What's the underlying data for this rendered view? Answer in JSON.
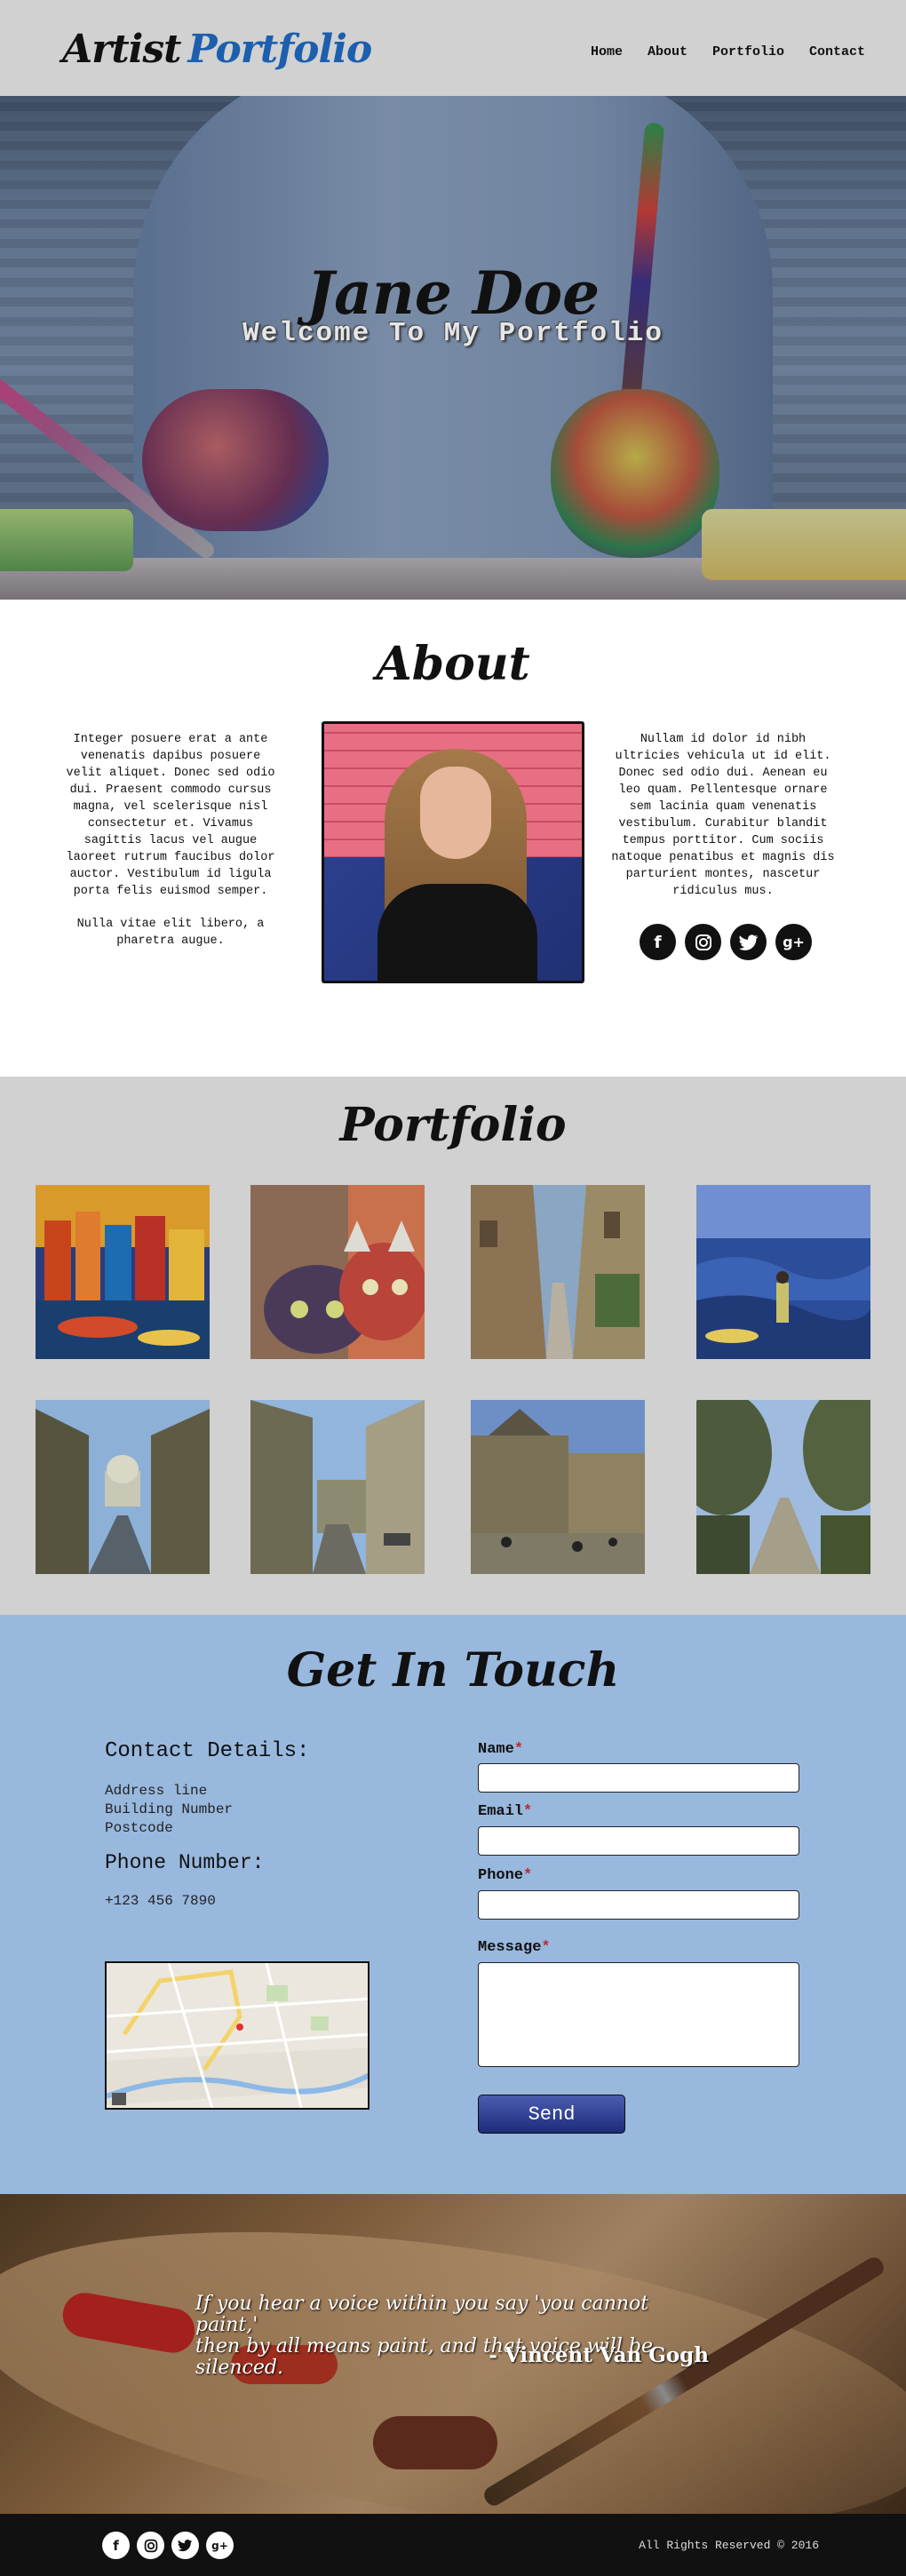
{
  "header": {
    "logo_first": "Artist",
    "logo_second": "Portfolio",
    "nav": [
      "Home",
      "About",
      "Portfolio",
      "Contact"
    ]
  },
  "hero": {
    "title": "Jane Doe",
    "subtitle": "Welcome To My Portfolio"
  },
  "about": {
    "title": "About",
    "left_paragraphs": [
      "Integer posuere erat a ante venenatis dapibus posuere velit aliquet. Donec sed odio dui. Praesent commodo cursus magna, vel scelerisque nisl consectetur et. Vivamus sagittis lacus vel augue laoreet rutrum faucibus dolor auctor. Vestibulum id ligula porta felis euismod semper.",
      "Nulla vitae elit libero, a pharetra augue."
    ],
    "right_paragraph": "Nullam id dolor id nibh ultricies vehicula ut id elit. Donec sed odio dui. Aenean eu leo quam. Pellentesque ornare sem lacinia quam venenatis vestibulum. Curabitur blandit tempus porttitor. Cum sociis natoque penatibus et magnis dis parturient montes, nascetur ridiculus mus.",
    "social_icons": [
      "facebook-icon",
      "instagram-icon",
      "twitter-icon",
      "google-plus-icon"
    ]
  },
  "portfolio": {
    "title": "Portfolio",
    "images": [
      "painted-city-canal-image",
      "painted-cats-image",
      "painted-alley-image",
      "painted-seaside-figure-image",
      "painted-domed-street-image",
      "painted-town-street-image",
      "painted-square-image",
      "painted-avenue-image"
    ]
  },
  "contact": {
    "title": "Get In Touch",
    "details_heading": "Contact Details:",
    "address_lines": [
      "Address line",
      "Building Number",
      "Postcode"
    ],
    "phone_heading": "Phone Number:",
    "phone": "+123 456 7890",
    "form": {
      "name_label": "Name",
      "email_label": "Email",
      "phone_label": "Phone",
      "message_label": "Message",
      "required_mark": "*",
      "send_label": "Send"
    }
  },
  "quote": {
    "line1": "If you hear a voice within you say 'you cannot paint,'",
    "line2": "then by all means paint, and that voice will be silenced.",
    "author": "- Vincent Van Gogh"
  },
  "footer": {
    "copyright": "All Rights Reserved © 2016"
  },
  "colors": {
    "header_bg": "#d1d1d1",
    "accent_blue": "#1c5fae",
    "contact_bg": "#98b8de",
    "send_button": "#2a3a8c",
    "required": "#c0282e",
    "footer_bg": "#111111"
  }
}
